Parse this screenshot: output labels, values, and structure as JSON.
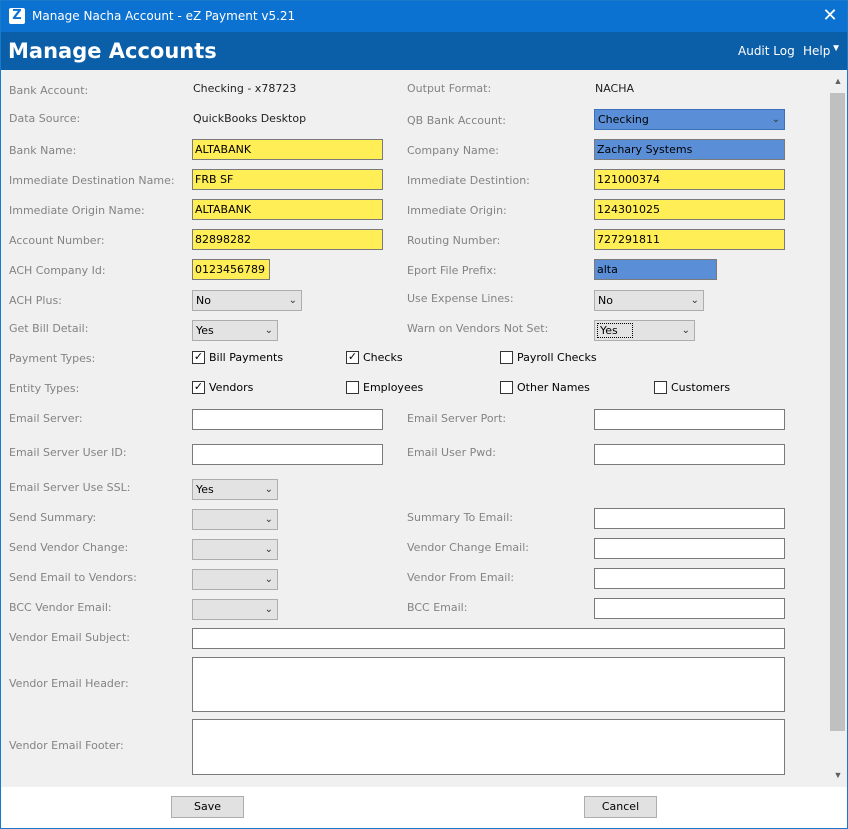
{
  "window": {
    "title": "Manage Nacha Account - eZ Payment v5.21",
    "app_icon": "Z",
    "close_glyph": "✕"
  },
  "header": {
    "title": "Manage Accounts",
    "audit_log": "Audit Log",
    "help": "Help"
  },
  "form": {
    "bank_account": {
      "label": "Bank Account:",
      "value": "Checking - x78723"
    },
    "output_format": {
      "label": "Output Format:",
      "value": "NACHA"
    },
    "data_source": {
      "label": "Data Source:",
      "value": "QuickBooks Desktop"
    },
    "qb_bank_account": {
      "label": "QB Bank Account:",
      "value": "Checking"
    },
    "bank_name": {
      "label": "Bank Name:",
      "value": "ALTABANK"
    },
    "company_name": {
      "label": "Company Name:",
      "value": "Zachary Systems"
    },
    "imm_dest_name": {
      "label": "Immediate Destination Name:",
      "value": "FRB SF"
    },
    "imm_dest": {
      "label": "Immediate Destintion:",
      "value": "121000374"
    },
    "imm_origin_name": {
      "label": "Immediate Origin Name:",
      "value": "ALTABANK"
    },
    "imm_origin": {
      "label": "Immediate Origin:",
      "value": "124301025"
    },
    "account_number": {
      "label": "Account Number:",
      "value": "82898282"
    },
    "routing_number": {
      "label": "Routing Number:",
      "value": "727291811"
    },
    "ach_company_id": {
      "label": "ACH Company Id:",
      "value": "0123456789"
    },
    "export_prefix": {
      "label": "Eport File Prefix:",
      "value": "alta"
    },
    "ach_plus": {
      "label": "ACH Plus:",
      "value": "No"
    },
    "use_expense_lines": {
      "label": "Use Expense Lines:",
      "value": "No"
    },
    "get_bill_detail": {
      "label": "Get Bill Detail:",
      "value": "Yes"
    },
    "warn_vendors": {
      "label": "Warn on Vendors Not Set:",
      "value": "Yes"
    },
    "payment_types": {
      "label": "Payment Types:",
      "options": [
        {
          "label": "Bill Payments",
          "checked": true
        },
        {
          "label": "Checks",
          "checked": true
        },
        {
          "label": "Payroll Checks",
          "checked": false
        }
      ]
    },
    "entity_types": {
      "label": "Entity Types:",
      "options": [
        {
          "label": "Vendors",
          "checked": true
        },
        {
          "label": "Employees",
          "checked": false
        },
        {
          "label": "Other Names",
          "checked": false
        },
        {
          "label": "Customers",
          "checked": false
        }
      ]
    },
    "email_server": {
      "label": "Email Server:",
      "value": ""
    },
    "email_server_port": {
      "label": "Email Server Port:",
      "value": ""
    },
    "email_user_id": {
      "label": "Email Server User ID:",
      "value": ""
    },
    "email_user_pwd": {
      "label": "Email User Pwd:",
      "value": ""
    },
    "email_ssl": {
      "label": "Email Server Use SSL:",
      "value": "Yes"
    },
    "send_summary": {
      "label": "Send Summary:",
      "value": ""
    },
    "summary_to_email": {
      "label": "Summary To Email:",
      "value": ""
    },
    "send_vendor_change": {
      "label": "Send Vendor Change:",
      "value": ""
    },
    "vendor_change_email": {
      "label": "Vendor Change Email:",
      "value": ""
    },
    "send_email_vendors": {
      "label": "Send Email to Vendors:",
      "value": ""
    },
    "vendor_from_email": {
      "label": "Vendor From Email:",
      "value": ""
    },
    "bcc_vendor_email": {
      "label": "BCC Vendor Email:",
      "value": ""
    },
    "bcc_email": {
      "label": "BCC Email:",
      "value": ""
    },
    "vendor_email_subject": {
      "label": "Vendor Email Subject:",
      "value": ""
    },
    "vendor_email_header": {
      "label": "Vendor Email Header:",
      "value": ""
    },
    "vendor_email_footer": {
      "label": "Vendor Email Footer:",
      "value": ""
    }
  },
  "footer": {
    "save": "Save",
    "cancel": "Cancel"
  },
  "icons": {
    "chevron": "chevron-down-icon",
    "check": "check-icon",
    "close": "close-icon"
  },
  "colors": {
    "titlebar": "#0b72d2",
    "header": "#0b5ea8",
    "required_field": "#ffee55",
    "selected_field": "#5a8fd8"
  }
}
